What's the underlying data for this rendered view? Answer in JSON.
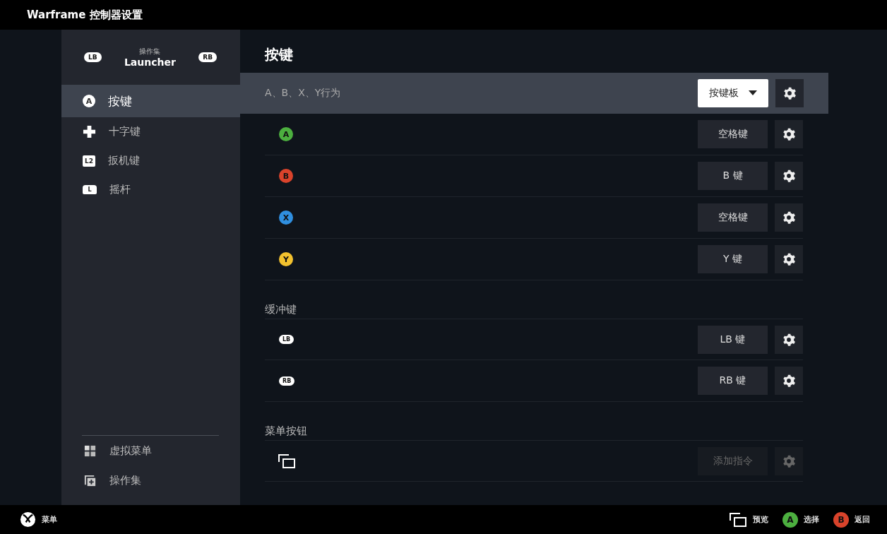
{
  "window": {
    "title": "Warframe 控制器设置"
  },
  "sidebar": {
    "action_set": {
      "caption": "操作集",
      "name": "Launcher",
      "prev": "LB",
      "next": "RB"
    },
    "items": [
      {
        "label": "按键",
        "kind": "face",
        "glyph": "A",
        "selected": true
      },
      {
        "label": "十字键",
        "kind": "dpad",
        "selected": false
      },
      {
        "label": "扳机键",
        "kind": "trigger",
        "glyph": "L2",
        "selected": false
      },
      {
        "label": "摇杆",
        "kind": "stick",
        "glyph": "L",
        "selected": false
      }
    ],
    "bottom_items": [
      {
        "label": "虚拟菜单",
        "kind": "grid",
        "selected": false
      },
      {
        "label": "操作集",
        "kind": "addset",
        "selected": false
      }
    ]
  },
  "content": {
    "title": "按键",
    "sections": [
      {
        "header": {
          "label": "A、B、X、Y行为",
          "dropdown": "按键板"
        },
        "rows": [
          {
            "kind": "face",
            "glyph": "A",
            "color": "#4caf3f",
            "binding": "空格键",
            "disabled": false
          },
          {
            "kind": "face",
            "glyph": "B",
            "color": "#d9432b",
            "binding": "B 键",
            "disabled": false
          },
          {
            "kind": "face",
            "glyph": "X",
            "color": "#2f8fe0",
            "binding": "空格键",
            "disabled": false
          },
          {
            "kind": "face",
            "glyph": "Y",
            "color": "#f2c12e",
            "binding": "Y 键",
            "disabled": false
          }
        ]
      },
      {
        "heading": "缓冲键",
        "rows": [
          {
            "kind": "bumper",
            "glyph": "LB",
            "binding": "LB 键",
            "disabled": false
          },
          {
            "kind": "bumper",
            "glyph": "RB",
            "binding": "RB 键",
            "disabled": false
          }
        ]
      },
      {
        "heading": "菜单按钮",
        "rows": [
          {
            "kind": "view",
            "binding": "添加指令",
            "disabled": true
          }
        ]
      }
    ]
  },
  "footer": {
    "menu": "菜单",
    "hints": [
      {
        "kind": "view",
        "label": "预览"
      },
      {
        "kind": "face",
        "glyph": "A",
        "color": "#4caf3f",
        "label": "选择"
      },
      {
        "kind": "face",
        "glyph": "B",
        "color": "#d9432b",
        "label": "返回"
      }
    ]
  }
}
